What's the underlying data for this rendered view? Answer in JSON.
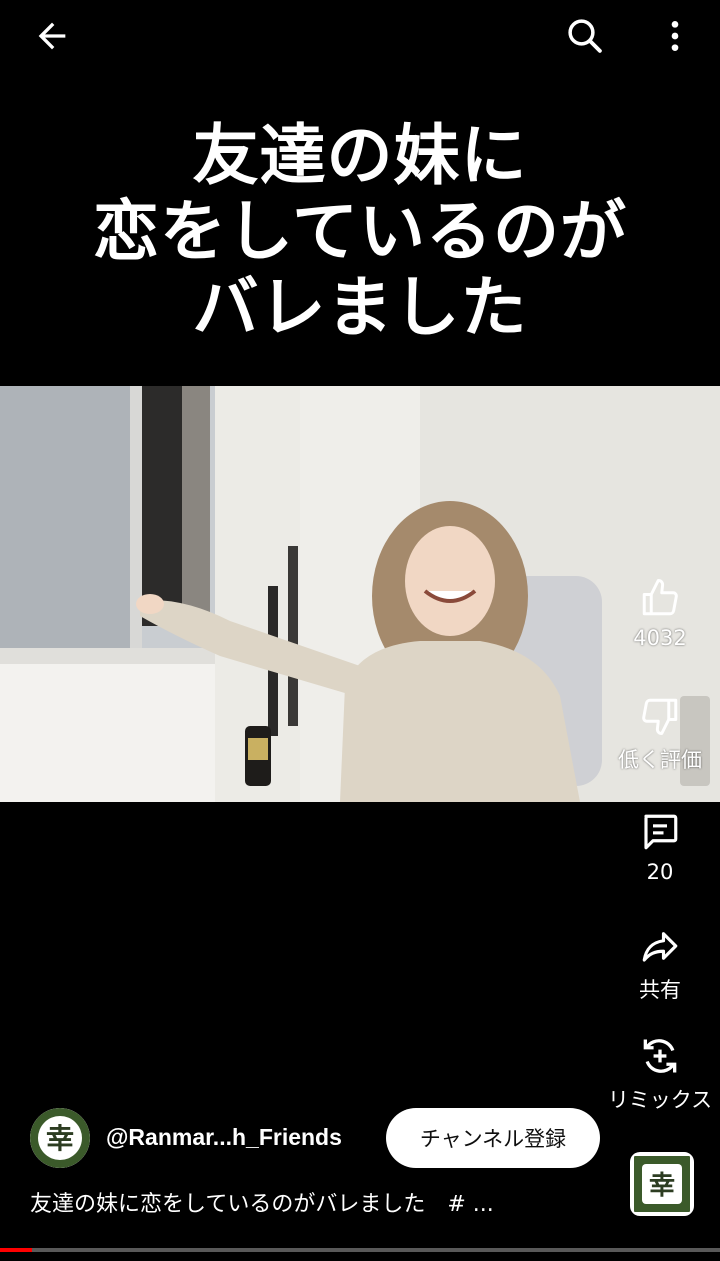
{
  "video": {
    "title_overlay_lines": [
      "友達の妹に",
      "恋をしているのが",
      "バレました"
    ],
    "progress_fraction": 0.045
  },
  "actions": {
    "like": {
      "icon": "thumb-up-icon",
      "label": "4032"
    },
    "dislike": {
      "icon": "thumb-down-icon",
      "label": "低く評価"
    },
    "comments": {
      "icon": "comment-icon",
      "label": "20"
    },
    "share": {
      "icon": "share-icon",
      "label": "共有"
    },
    "remix": {
      "icon": "remix-icon",
      "label": "リミックス"
    }
  },
  "channel": {
    "handle": "@Ranmar...h_Friends",
    "subscribe_label": "チャンネル登録",
    "avatar_glyph": "幸"
  },
  "description": "友達の妹に恋をしているのがバレました　# ...",
  "colors": {
    "background": "#000000",
    "progress": "#ff0000",
    "avatar_green": "#3b5a2a"
  }
}
